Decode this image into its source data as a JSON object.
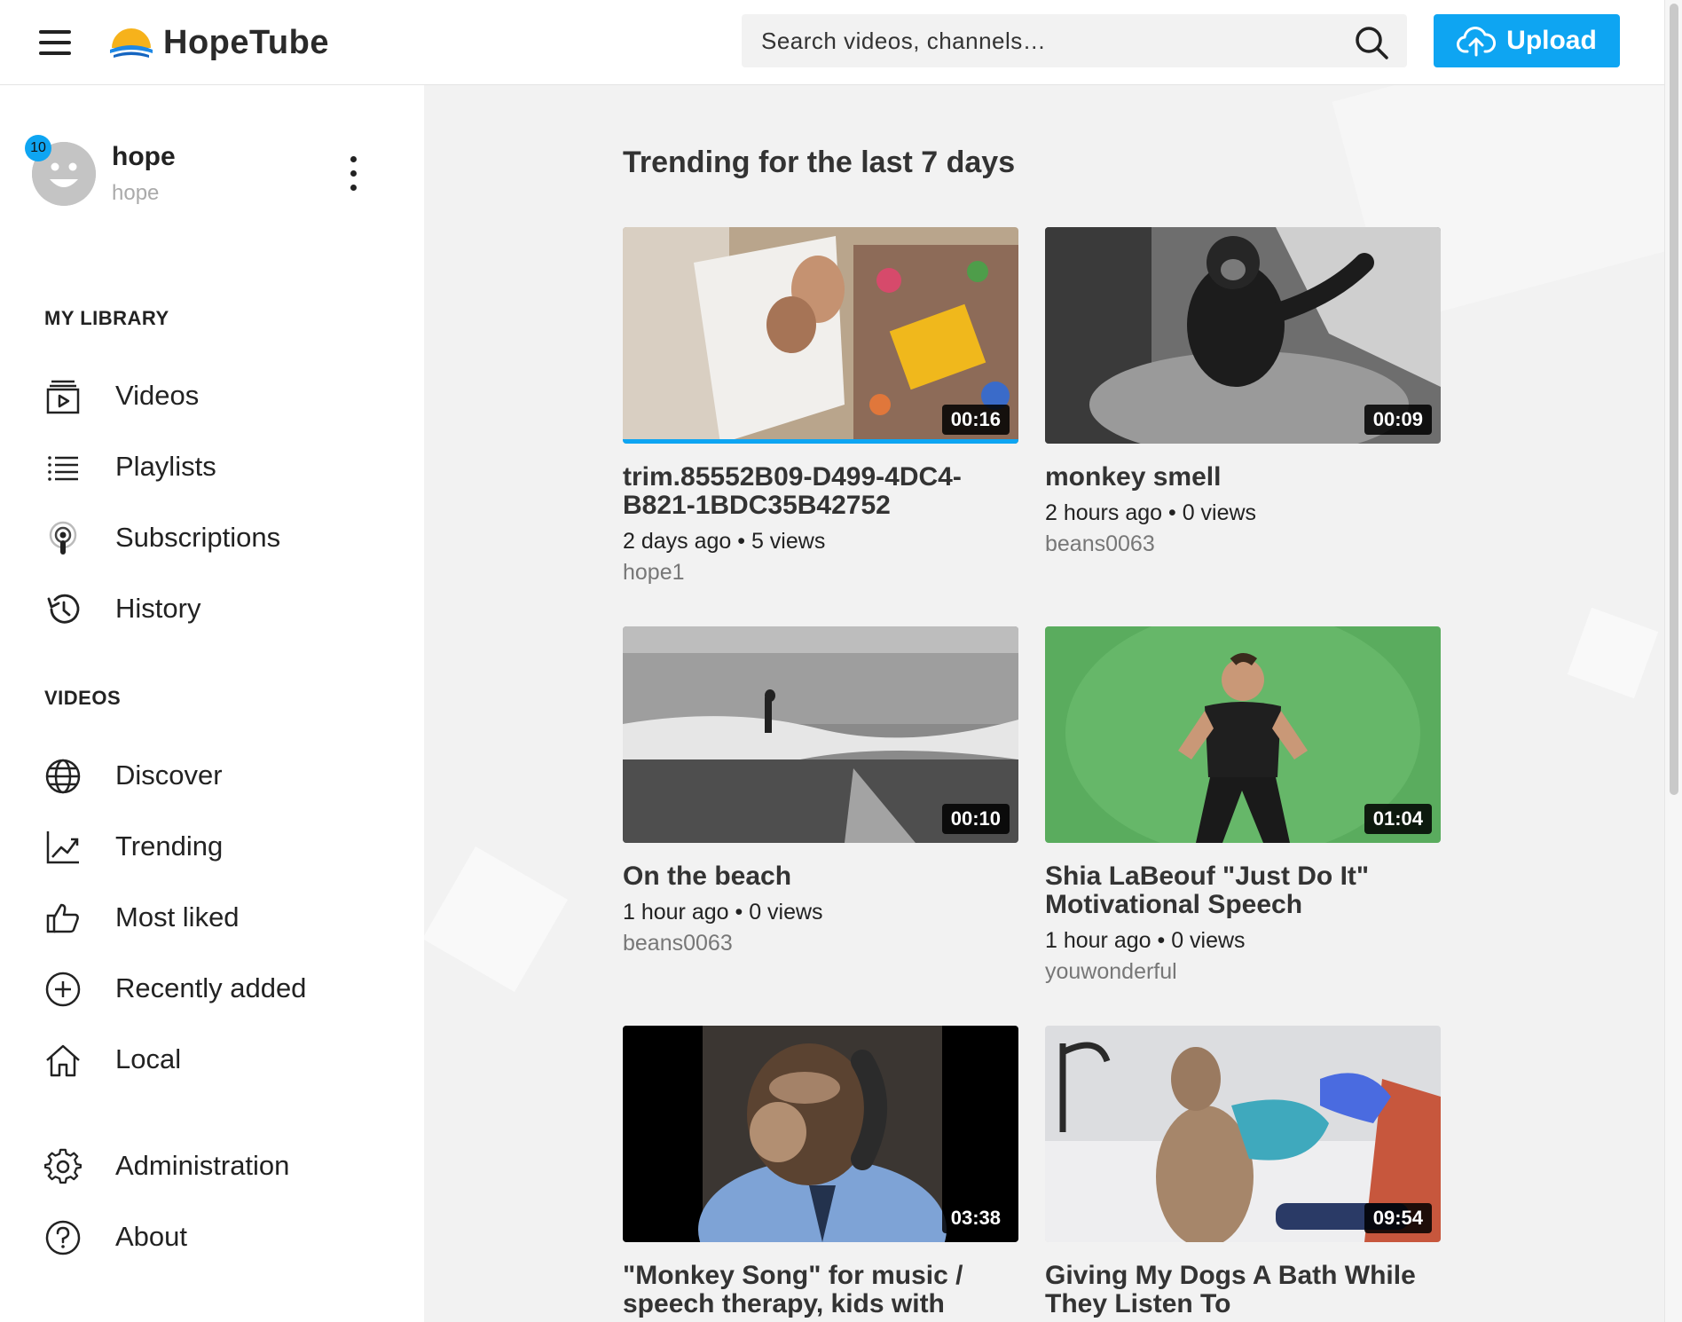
{
  "header": {
    "logo_text": "HopeTube",
    "search_placeholder": "Search videos, channels…",
    "upload_label": "Upload"
  },
  "user": {
    "name": "hope",
    "handle": "hope",
    "notification_count": "10"
  },
  "sidebar": {
    "library_title": "MY LIBRARY",
    "library_items": [
      {
        "label": "Videos",
        "icon": "video-library-icon"
      },
      {
        "label": "Playlists",
        "icon": "list-icon"
      },
      {
        "label": "Subscriptions",
        "icon": "podcast-icon"
      },
      {
        "label": "History",
        "icon": "history-icon"
      }
    ],
    "videos_title": "VIDEOS",
    "video_items": [
      {
        "label": "Discover",
        "icon": "globe-icon"
      },
      {
        "label": "Trending",
        "icon": "trending-chart-icon"
      },
      {
        "label": "Most liked",
        "icon": "thumbs-up-icon"
      },
      {
        "label": "Recently added",
        "icon": "plus-circle-icon"
      },
      {
        "label": "Local",
        "icon": "home-icon"
      }
    ],
    "other_items": [
      {
        "label": "Administration",
        "icon": "gear-icon"
      },
      {
        "label": "About",
        "icon": "help-circle-icon"
      }
    ]
  },
  "main": {
    "title": "Trending for the last 7 days",
    "videos": [
      {
        "title": "trim.85552B09-D499-4DC4-B821-1BDC35B42752",
        "duration": "00:16",
        "meta": "2 days ago • 5 views",
        "channel": "hope1",
        "watched": true
      },
      {
        "title": "monkey smell",
        "duration": "00:09",
        "meta": "2 hours ago • 0 views",
        "channel": "beans0063",
        "watched": false
      },
      {
        "title": "On the beach",
        "duration": "00:10",
        "meta": "1 hour ago • 0 views",
        "channel": "beans0063",
        "watched": false
      },
      {
        "title": "Shia LaBeouf \"Just Do It\" Motivational Speech",
        "duration": "01:04",
        "meta": "1 hour ago • 0 views",
        "channel": "youwonderful",
        "watched": false
      },
      {
        "title": "\"Monkey Song\" for music / speech therapy, kids with",
        "duration": "03:38",
        "meta": "",
        "channel": "",
        "watched": false
      },
      {
        "title": "Giving My Dogs A Bath While They Listen To",
        "duration": "09:54",
        "meta": "",
        "channel": "",
        "watched": false
      }
    ]
  },
  "colors": {
    "accent": "#0ea5f2",
    "text": "#222222",
    "muted": "#777777"
  }
}
